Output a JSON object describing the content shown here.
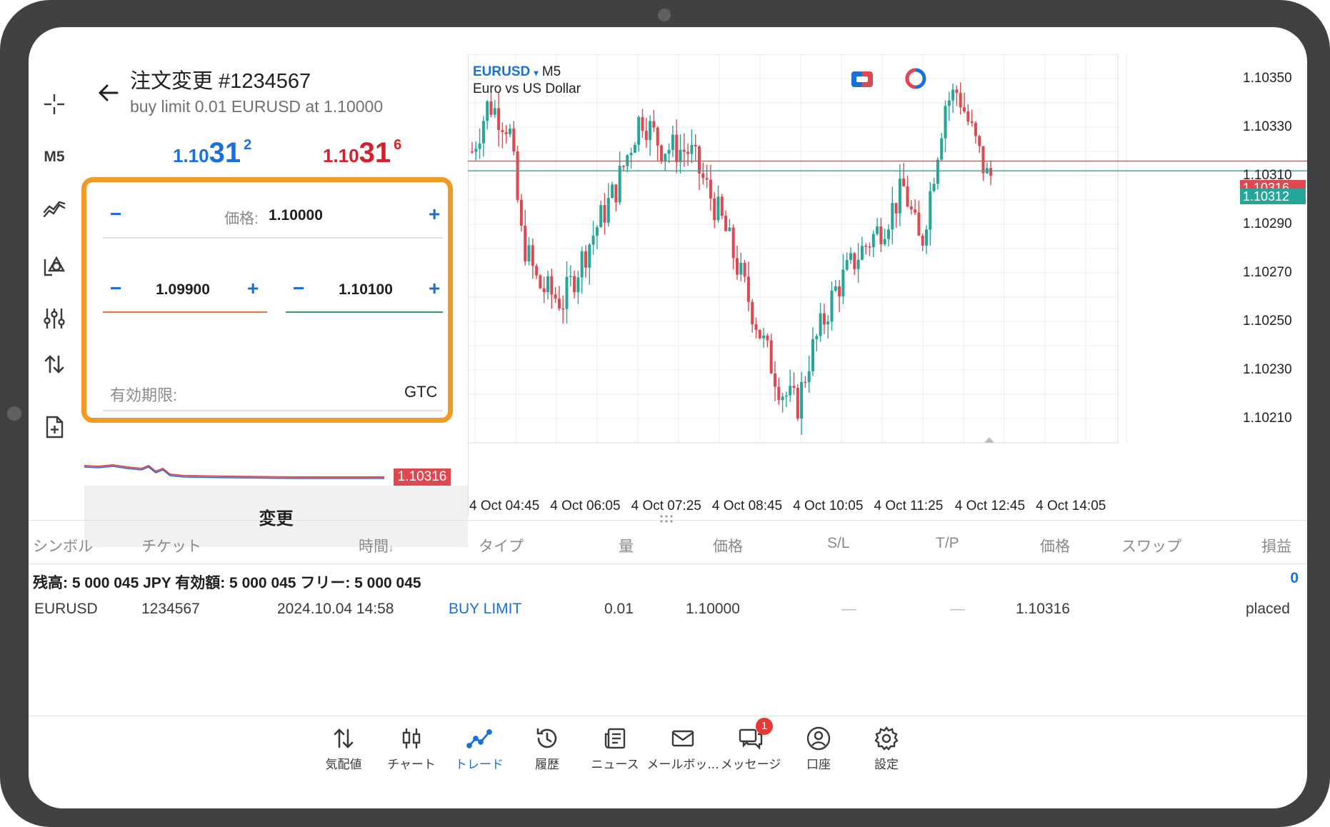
{
  "toolbar": {
    "timeframe_label": "M5"
  },
  "order": {
    "title": "注文変更 #1234567",
    "subtitle": "buy limit 0.01 EURUSD at 1.10000",
    "bid": {
      "prefix": "1.10",
      "big": "31",
      "sup": "2"
    },
    "ask": {
      "prefix": "1.10",
      "big": "31",
      "sup": "6"
    },
    "price_label": "価格:",
    "price_value": "1.10000",
    "sl_value": "1.09900",
    "tp_value": "1.10100",
    "expiration_label": "有効期限:",
    "expiration_value": "GTC",
    "minus": "−",
    "plus": "+",
    "mini_price": "1.10316",
    "submit_label": "変更"
  },
  "chart": {
    "symbol": "EURUSD",
    "symbol_caret": "▾",
    "timeframe": "M5",
    "description": "Euro vs US Dollar",
    "colors": {
      "up": "#26a69a",
      "down": "#e0474f",
      "bid_line": "#26a69a",
      "ask_line": "#e0474f"
    }
  },
  "chart_data": {
    "type": "candlestick",
    "price_ticks": [
      "1.10350",
      "1.10330",
      "1.10310",
      "1.10290",
      "1.10270",
      "1.10250",
      "1.10230",
      "1.10210"
    ],
    "time_ticks": [
      "4 Oct 04:45",
      "4 Oct 06:05",
      "4 Oct 07:25",
      "4 Oct 08:45",
      "4 Oct 10:05",
      "4 Oct 11:25",
      "4 Oct 12:45",
      "4 Oct 14:05"
    ],
    "ask_price": "1.10316",
    "bid_price": "1.10312",
    "ylim": [
      1.102,
      1.1036
    ],
    "grid": true
  },
  "table": {
    "headers": [
      "シンボル",
      "チケット",
      "時間",
      "タイプ",
      "量",
      "価格",
      "S/L",
      "T/P",
      "価格",
      "スワップ",
      "損益"
    ],
    "sort_arrow": "↓",
    "balance_text": "残高: 5 000 045 JPY  有効額: 5 000 045  フリー: 5 000 045",
    "total_profit": "0",
    "rows": [
      {
        "symbol": "EURUSD",
        "ticket": "1234567",
        "time": "2024.10.04 14:58",
        "type": "BUY LIMIT",
        "volume": "0.01",
        "price": "1.10000",
        "sl": "—",
        "tp": "—",
        "current": "1.10316",
        "state": "placed"
      }
    ]
  },
  "nav": {
    "items": [
      {
        "label": "気配値",
        "icon": "quotes-icon"
      },
      {
        "label": "チャート",
        "icon": "chart-icon"
      },
      {
        "label": "トレード",
        "icon": "trade-icon",
        "active": true
      },
      {
        "label": "履歴",
        "icon": "history-icon"
      },
      {
        "label": "ニュース",
        "icon": "news-icon"
      },
      {
        "label": "メールボッ...",
        "icon": "mail-icon"
      },
      {
        "label": "メッセージ",
        "icon": "messages-icon",
        "badge": "1"
      },
      {
        "label": "口座",
        "icon": "account-icon"
      },
      {
        "label": "設定",
        "icon": "settings-icon"
      }
    ]
  }
}
